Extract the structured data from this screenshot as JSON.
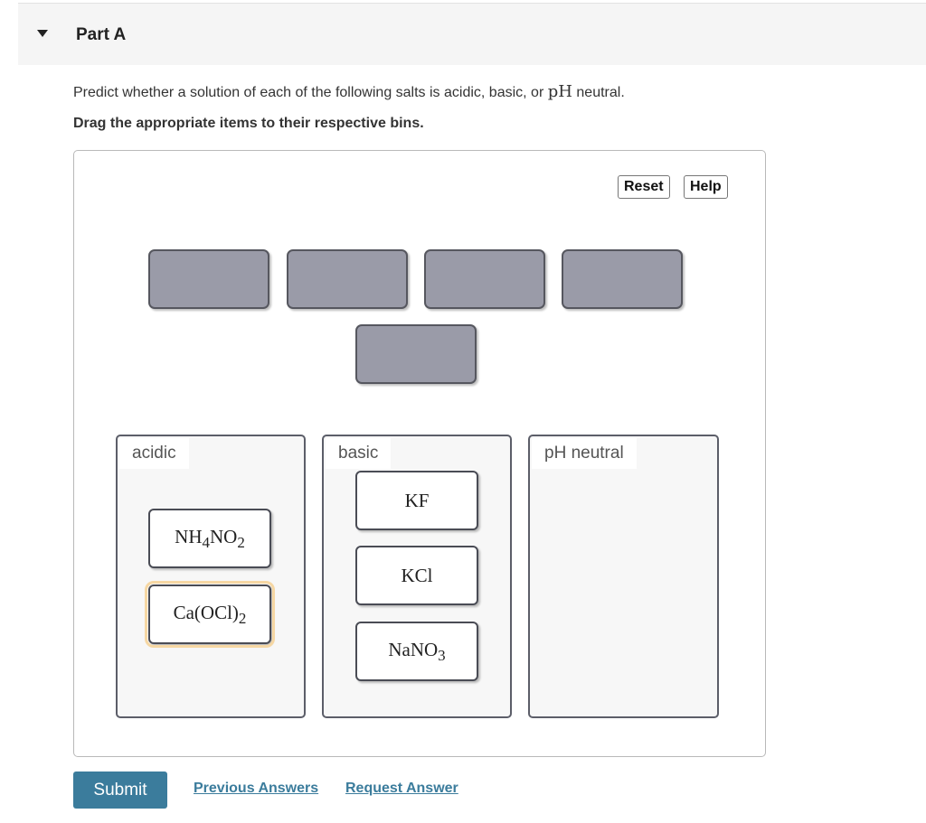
{
  "part": {
    "title": "Part A",
    "expanded": true
  },
  "prompt": {
    "text_before": "Predict whether a solution of each of the following salts is acidic, basic, or ",
    "math": "pH",
    "text_after": " neutral."
  },
  "instruction": "Drag the appropriate items to their respective bins.",
  "toolbar": {
    "reset_label": "Reset",
    "help_label": "Help"
  },
  "empty_slots_count": 5,
  "bins": [
    {
      "label": "acidic",
      "items": [
        {
          "formula": [
            [
              "NH",
              ""
            ],
            [
              "4",
              "sub"
            ],
            [
              "NO",
              ""
            ],
            [
              "2",
              "sub"
            ]
          ],
          "text": "NH4NO2",
          "selected": false
        },
        {
          "formula": [
            [
              "Ca(OCl)",
              ""
            ],
            [
              "2",
              "sub"
            ]
          ],
          "text": "Ca(OCl)2",
          "selected": true
        }
      ]
    },
    {
      "label": "basic",
      "items": [
        {
          "formula": [
            [
              "KF",
              ""
            ]
          ],
          "text": "KF",
          "selected": false
        },
        {
          "formula": [
            [
              "KCl",
              ""
            ]
          ],
          "text": "KCl",
          "selected": false
        },
        {
          "formula": [
            [
              "NaNO",
              ""
            ],
            [
              "3",
              "sub"
            ]
          ],
          "text": "NaNO3",
          "selected": false
        }
      ]
    },
    {
      "label": "pH neutral",
      "items": []
    }
  ],
  "actions": {
    "submit_label": "Submit",
    "previous_answers_label": "Previous Answers",
    "request_answer_label": "Request Answer"
  },
  "colors": {
    "accent": "#3b7c9c",
    "slot_fill": "#9a9ba8",
    "selection_outline": "#f6d7a3"
  }
}
